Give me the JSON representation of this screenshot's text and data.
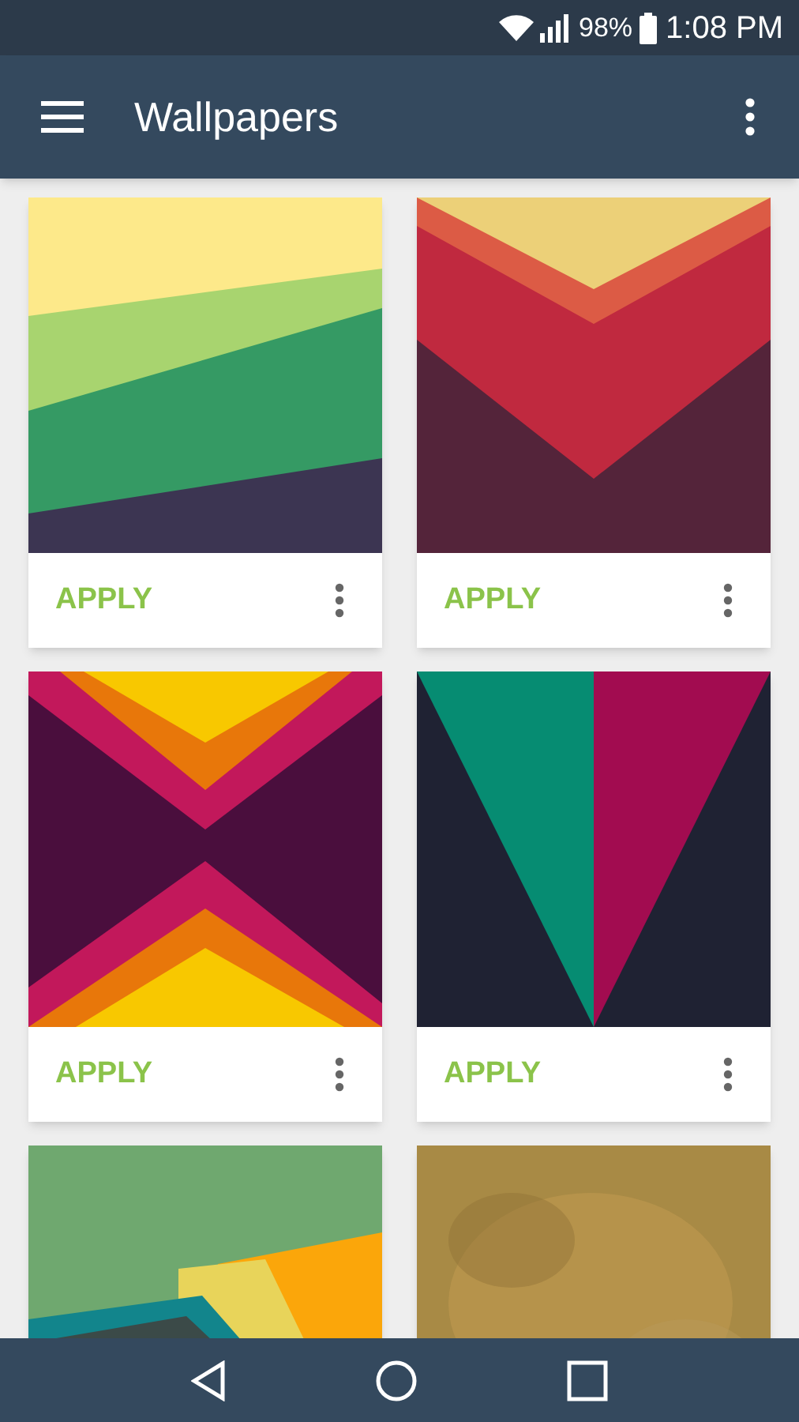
{
  "status_bar": {
    "battery": "98%",
    "time": "1:08 PM"
  },
  "app_bar": {
    "title": "Wallpapers"
  },
  "wallpapers": [
    {
      "kind": "picture",
      "action": "APPLY"
    },
    {
      "kind": "picture",
      "action": "APPLY"
    },
    {
      "kind": "picture",
      "action": "APPLY"
    },
    {
      "kind": "picture",
      "action": "APPLY"
    },
    {
      "kind": "picture"
    },
    {
      "kind": "picture"
    }
  ]
}
